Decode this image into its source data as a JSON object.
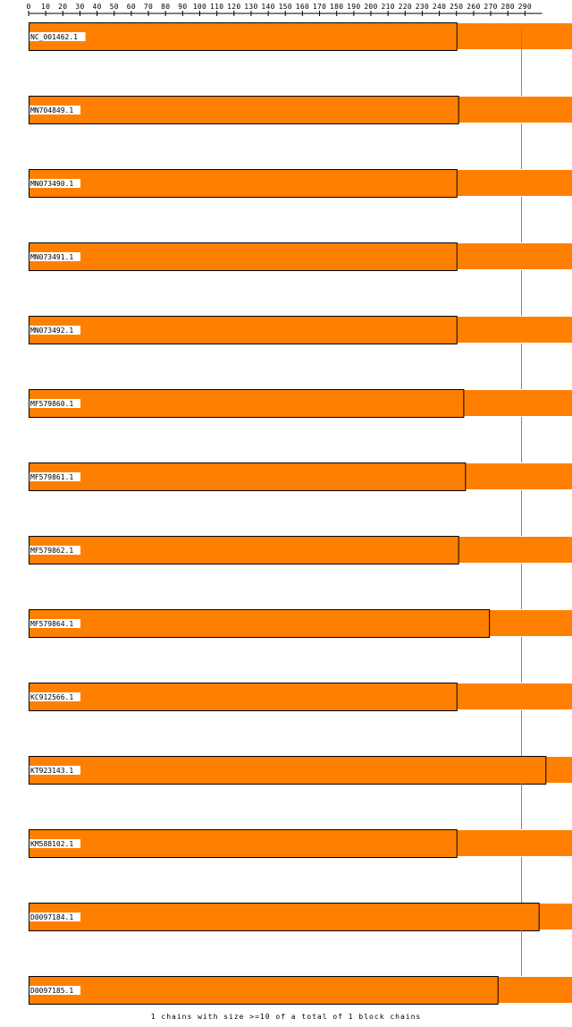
{
  "chart_data": {
    "type": "bar",
    "orientation": "horizontal",
    "axis": {
      "ticks": [
        0,
        10,
        20,
        30,
        40,
        50,
        60,
        70,
        80,
        90,
        100,
        110,
        120,
        130,
        140,
        150,
        160,
        170,
        180,
        190,
        200,
        210,
        220,
        230,
        240,
        250,
        260,
        270,
        280,
        290
      ],
      "range": [
        0,
        300
      ]
    },
    "reference_line": 288,
    "series": [
      {
        "label": "NC_001462.1",
        "block_end": 250
      },
      {
        "label": "MN704849.1",
        "block_end": 251
      },
      {
        "label": "MN073490.1",
        "block_end": 250
      },
      {
        "label": "MN073491.1",
        "block_end": 250
      },
      {
        "label": "MN073492.1",
        "block_end": 250
      },
      {
        "label": "MF579860.1",
        "block_end": 254
      },
      {
        "label": "MF579861.1",
        "block_end": 255
      },
      {
        "label": "MF579862.1",
        "block_end": 251
      },
      {
        "label": "MF579864.1",
        "block_end": 269
      },
      {
        "label": "KC912566.1",
        "block_end": 250
      },
      {
        "label": "KT923143.1",
        "block_end": 302
      },
      {
        "label": "KM588102.1",
        "block_end": 250
      },
      {
        "label": "D0097184.1",
        "block_end": 298
      },
      {
        "label": "D0097185.1",
        "block_end": 274
      }
    ],
    "footer": "1 chains with size >=10 of a total of 1 block chains"
  },
  "colors": {
    "bar_fill": "#ff8000",
    "bar_outline": "#000000",
    "ref_line": "#cc7a00",
    "axis": "#000000"
  }
}
